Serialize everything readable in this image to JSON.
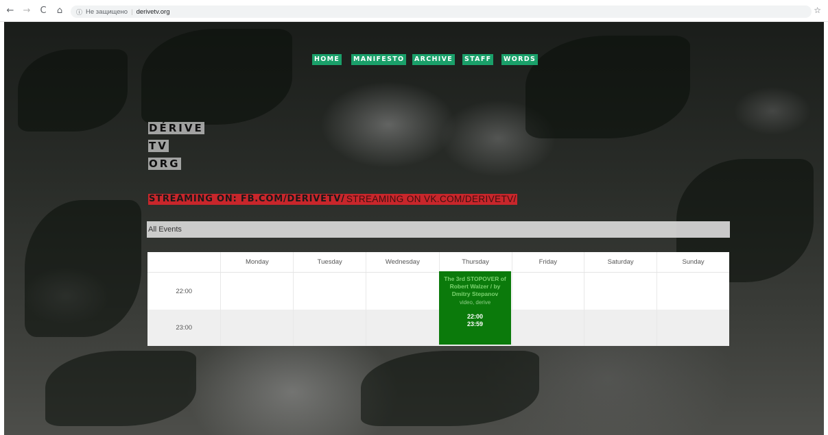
{
  "browser": {
    "back_glyph": "←",
    "forward_glyph": "→",
    "reload_glyph": "C",
    "home_glyph": "⌂",
    "info_glyph": "ⓘ",
    "security_label": "Не защищено",
    "separator": "|",
    "url": "derivetv.org",
    "star_glyph": "☆"
  },
  "menu": {
    "items": [
      {
        "label": "HOME"
      },
      {
        "label": "MANIFESTO"
      },
      {
        "label": "ARCHIVE"
      },
      {
        "label": "STAFF"
      },
      {
        "label": "WORDS"
      }
    ],
    "color": "#1aa06a"
  },
  "logo": {
    "lines": [
      "DÉRIVE",
      "TV",
      "ORG"
    ]
  },
  "streaming": {
    "primary": "STREAMING ON: FB.COM/DERIVETV/",
    "secondary": " STREAMING ON VK.COM/DERIVETV/",
    "color": "#c8262b"
  },
  "events_filter": {
    "label": "All Events"
  },
  "calendar": {
    "days": [
      "Monday",
      "Tuesday",
      "Wednesday",
      "Thursday",
      "Friday",
      "Saturday",
      "Sunday"
    ],
    "times": [
      "22:00",
      "23:00"
    ],
    "event": {
      "day": "Thursday",
      "title": "The 3rd STOPOVER of Robert Walzer / by Dmitry Stepanov",
      "tags": "video, derive",
      "start": "22:00",
      "end": "23:59",
      "color": "#0b7a0b"
    }
  }
}
